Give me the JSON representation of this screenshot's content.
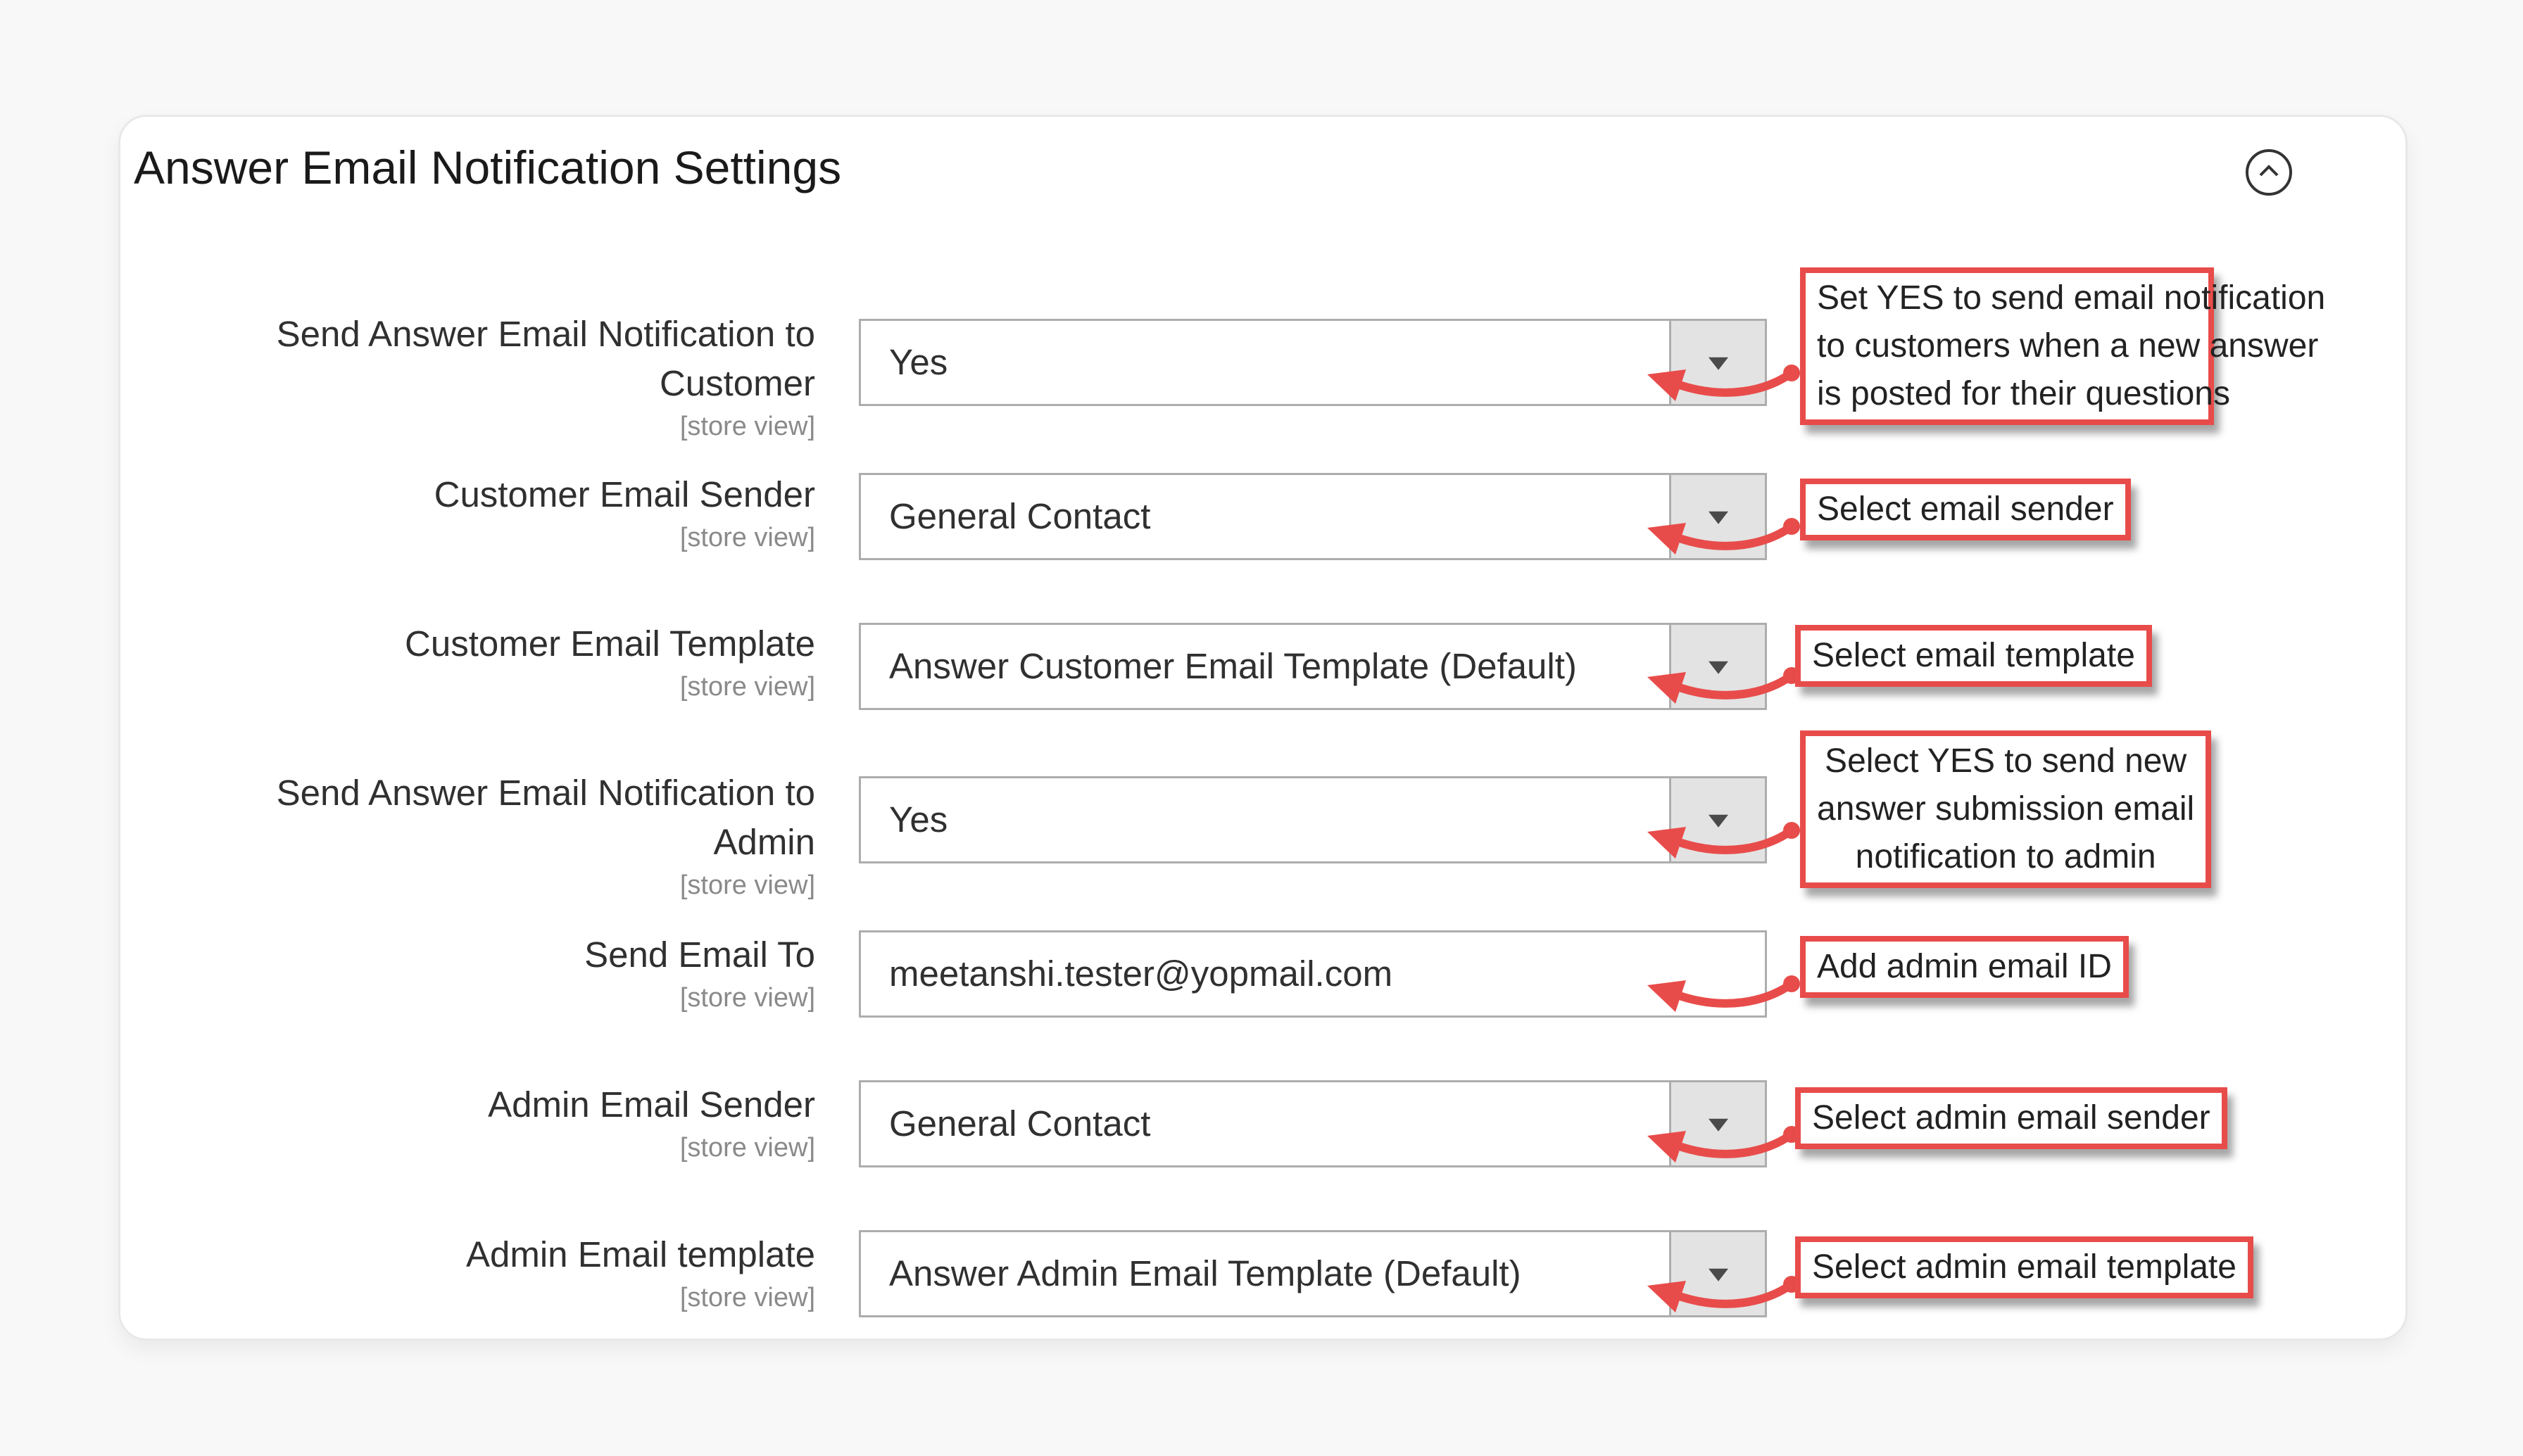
{
  "panel": {
    "title": "Answer Email Notification Settings",
    "collapse_icon": "chevron-up-circle-icon"
  },
  "fields": [
    {
      "label_line1": "Send Answer Email Notification to",
      "label_line2": "Customer",
      "scope": "[store view]",
      "type": "select",
      "value": "Yes",
      "callout": [
        "Set YES to send email notification",
        "to customers when a new answer",
        "is posted for their questions"
      ]
    },
    {
      "label_line1": "Customer Email Sender",
      "scope": "[store view]",
      "type": "select",
      "value": "General Contact",
      "callout": [
        "Select email sender"
      ]
    },
    {
      "label_line1": "Customer Email Template",
      "scope": "[store view]",
      "type": "select",
      "value": "Answer Customer Email Template (Default)",
      "callout": [
        "Select email template"
      ]
    },
    {
      "label_line1": "Send Answer Email Notification to",
      "label_line2": "Admin",
      "scope": "[store view]",
      "type": "select",
      "value": "Yes",
      "callout": [
        "Select YES to send new",
        "answer submission email",
        "notification to admin"
      ]
    },
    {
      "label_line1": "Send Email To",
      "scope": "[store view]",
      "type": "text",
      "value": "meetanshi.tester@yopmail.com",
      "callout": [
        "Add admin email ID"
      ]
    },
    {
      "label_line1": "Admin Email Sender",
      "scope": "[store view]",
      "type": "select",
      "value": "General Contact",
      "callout": [
        "Select admin email sender"
      ]
    },
    {
      "label_line1": "Admin Email template",
      "scope": "[store view]",
      "type": "select",
      "value": "Answer Admin Email Template (Default)",
      "callout": [
        "Select admin email template"
      ]
    }
  ],
  "colors": {
    "annotation_red": "#e84c4a",
    "select_button_bg": "#e3e3e3",
    "field_border": "#adadad",
    "scope_text": "#8a8a8a"
  }
}
